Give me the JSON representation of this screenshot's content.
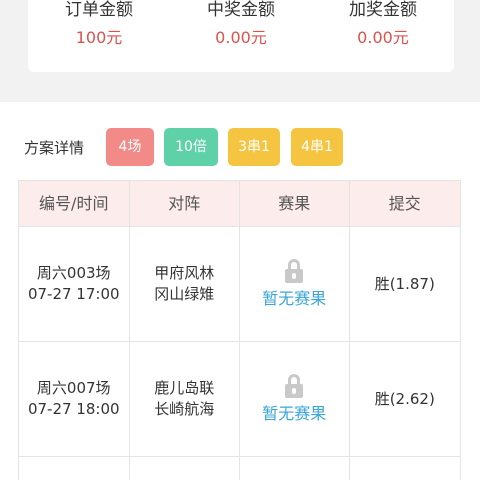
{
  "summary": {
    "order_amount": {
      "label": "订单金额",
      "value": "100元"
    },
    "win_amount": {
      "label": "中奖金额",
      "value": "0.00元"
    },
    "bonus_amount": {
      "label": "加奖金额",
      "value": "0.00元"
    }
  },
  "details": {
    "title": "方案详情",
    "tags": [
      "4场",
      "10倍",
      "3串1",
      "4串1"
    ]
  },
  "table": {
    "headers": [
      "编号/时间",
      "对阵",
      "赛果",
      "提交"
    ],
    "rows": [
      {
        "id": "周六003场",
        "time": "07-27 17:00",
        "home": "甲府风林",
        "away": "冈山绿雉",
        "result": "暂无赛果",
        "pick": "胜(1.87)"
      },
      {
        "id": "周六007场",
        "time": "07-27 18:00",
        "home": "鹿儿岛联",
        "away": "长崎航海",
        "result": "暂无赛果",
        "pick": "胜(2.62)"
      }
    ]
  },
  "colors": {
    "amount": "#d9534f",
    "tag_red": "#f28b87",
    "tag_green": "#5fd1a8",
    "tag_yellow": "#f5c542",
    "link": "#3aa6d8",
    "header_bg": "#fcecec"
  }
}
